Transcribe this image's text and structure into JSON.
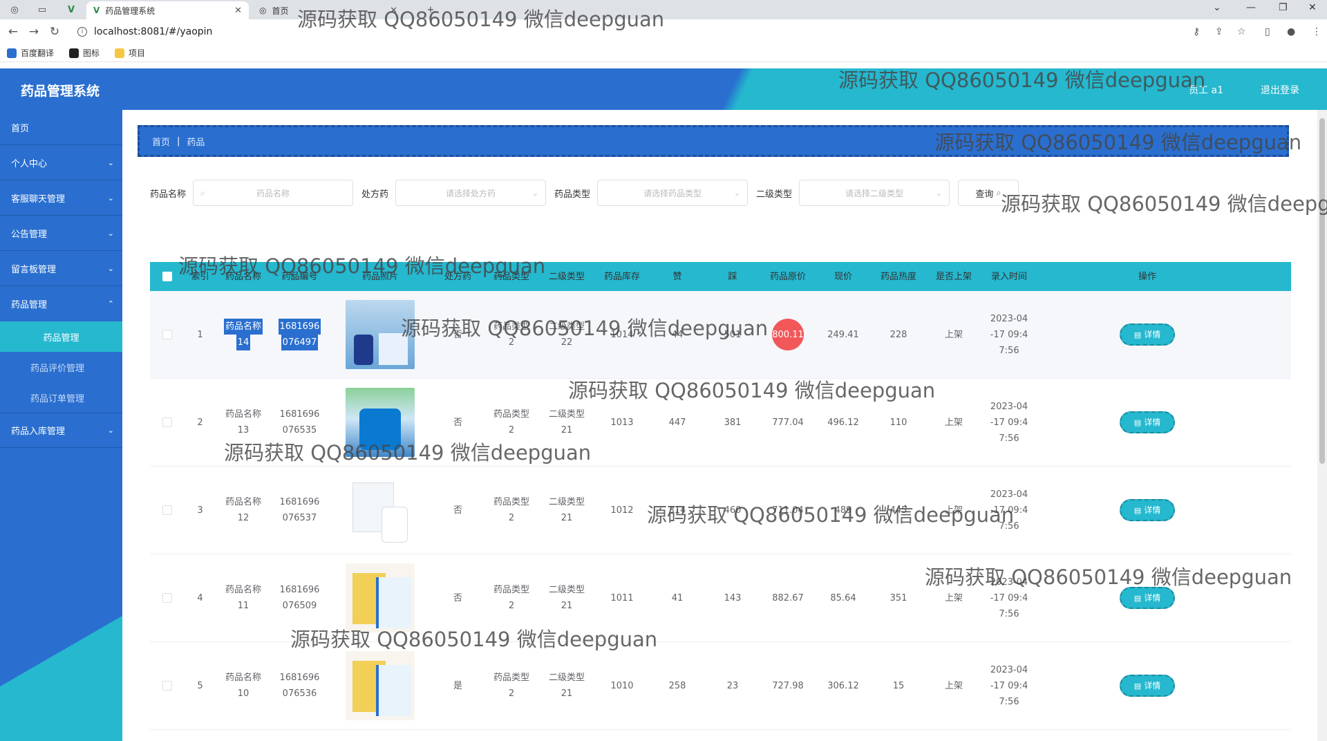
{
  "browser": {
    "tabs": [
      {
        "label": "药品管理系统",
        "active": true
      },
      {
        "label": "首页",
        "active": false
      }
    ],
    "new_tab": "+",
    "url": "localhost:8081/#/yaopin",
    "bookmarks": [
      "百度翻译",
      "图标",
      "项目"
    ]
  },
  "header": {
    "title": "药品管理系统",
    "user": "员工 a1",
    "logout": "退出登录"
  },
  "sidebar": {
    "items": [
      {
        "label": "首页",
        "expandable": false
      },
      {
        "label": "个人中心",
        "expandable": true
      },
      {
        "label": "客服聊天管理",
        "expandable": true
      },
      {
        "label": "公告管理",
        "expandable": true
      },
      {
        "label": "留言板管理",
        "expandable": true
      },
      {
        "label": "药品管理",
        "expandable": true
      },
      {
        "label": "药品入库管理",
        "expandable": true
      }
    ],
    "submenu": [
      {
        "label": "药品管理",
        "active": true
      },
      {
        "label": "药品评价管理",
        "active": false
      },
      {
        "label": "药品订单管理",
        "active": false
      }
    ]
  },
  "breadcrumb": [
    "首页",
    "药品"
  ],
  "search": {
    "name_label": "药品名称",
    "name_placeholder": "药品名称",
    "rx_label": "处方药",
    "rx_placeholder": "请选择处方药",
    "type_label": "药品类型",
    "type_placeholder": "请选择药品类型",
    "sub_label": "二级类型",
    "sub_placeholder": "请选择二级类型",
    "query_button": "查询"
  },
  "table": {
    "headers": [
      "索引",
      "药品名称",
      "药品编号",
      "药品照片",
      "处方药",
      "药品类型",
      "二级类型",
      "药品库存",
      "赞",
      "踩",
      "药品原价",
      "现价",
      "药品热度",
      "是否上架",
      "录入时间",
      "操作"
    ],
    "detail_label": "详情",
    "rows": [
      {
        "index": "1",
        "name": [
          "药品名称",
          "14"
        ],
        "code": [
          "1681696",
          "076497"
        ],
        "rx": "否",
        "type": [
          "药品类型",
          "2"
        ],
        "sub": [
          "二级类型",
          "22"
        ],
        "stock": "1014",
        "up": "44",
        "down": "501",
        "orig": "800.11",
        "now": "249.41",
        "heat": "228",
        "shelf": "上架",
        "time": [
          "2023-04",
          "-17 09:4",
          "7:56"
        ]
      },
      {
        "index": "2",
        "name": [
          "药品名称",
          "13"
        ],
        "code": [
          "1681696",
          "076535"
        ],
        "rx": "否",
        "type": [
          "药品类型",
          "2"
        ],
        "sub": [
          "二级类型",
          "21"
        ],
        "stock": "1013",
        "up": "447",
        "down": "381",
        "orig": "777.04",
        "now": "496.12",
        "heat": "110",
        "shelf": "上架",
        "time": [
          "2023-04",
          "-17 09:4",
          "7:56"
        ]
      },
      {
        "index": "3",
        "name": [
          "药品名称",
          "12"
        ],
        "code": [
          "1681696",
          "076537"
        ],
        "rx": "否",
        "type": [
          "药品类型",
          "2"
        ],
        "sub": [
          "二级类型",
          "21"
        ],
        "stock": "1012",
        "up": "314",
        "down": "460",
        "orig": "711.04",
        "now": "489",
        "heat": "445",
        "shelf": "上架",
        "time": [
          "2023-04",
          "-17 09:4",
          "7:56"
        ]
      },
      {
        "index": "4",
        "name": [
          "药品名称",
          "11"
        ],
        "code": [
          "1681696",
          "076509"
        ],
        "rx": "否",
        "type": [
          "药品类型",
          "2"
        ],
        "sub": [
          "二级类型",
          "21"
        ],
        "stock": "1011",
        "up": "41",
        "down": "143",
        "orig": "882.67",
        "now": "85.64",
        "heat": "351",
        "shelf": "上架",
        "time": [
          "2023-04",
          "-17 09:4",
          "7:56"
        ]
      },
      {
        "index": "5",
        "name": [
          "药品名称",
          "10"
        ],
        "code": [
          "1681696",
          "076536"
        ],
        "rx": "是",
        "type": [
          "药品类型",
          "2"
        ],
        "sub": [
          "二级类型",
          "21"
        ],
        "stock": "1010",
        "up": "258",
        "down": "23",
        "orig": "727.98",
        "now": "306.12",
        "heat": "15",
        "shelf": "上架",
        "time": [
          "2023-04",
          "-17 09:4",
          "7:56"
        ]
      }
    ]
  },
  "watermark": "源码获取 QQ86050149 微信deepguan",
  "icons": {
    "search": "search-icon",
    "select_arrow": "chevron-down-icon",
    "detail": "document-icon",
    "menu_chevron": "chevron-down-icon"
  },
  "colors": {
    "primary_blue": "#2a6fcf",
    "accent_cyan": "#25b8cf",
    "click_marker": "#f2575a"
  }
}
